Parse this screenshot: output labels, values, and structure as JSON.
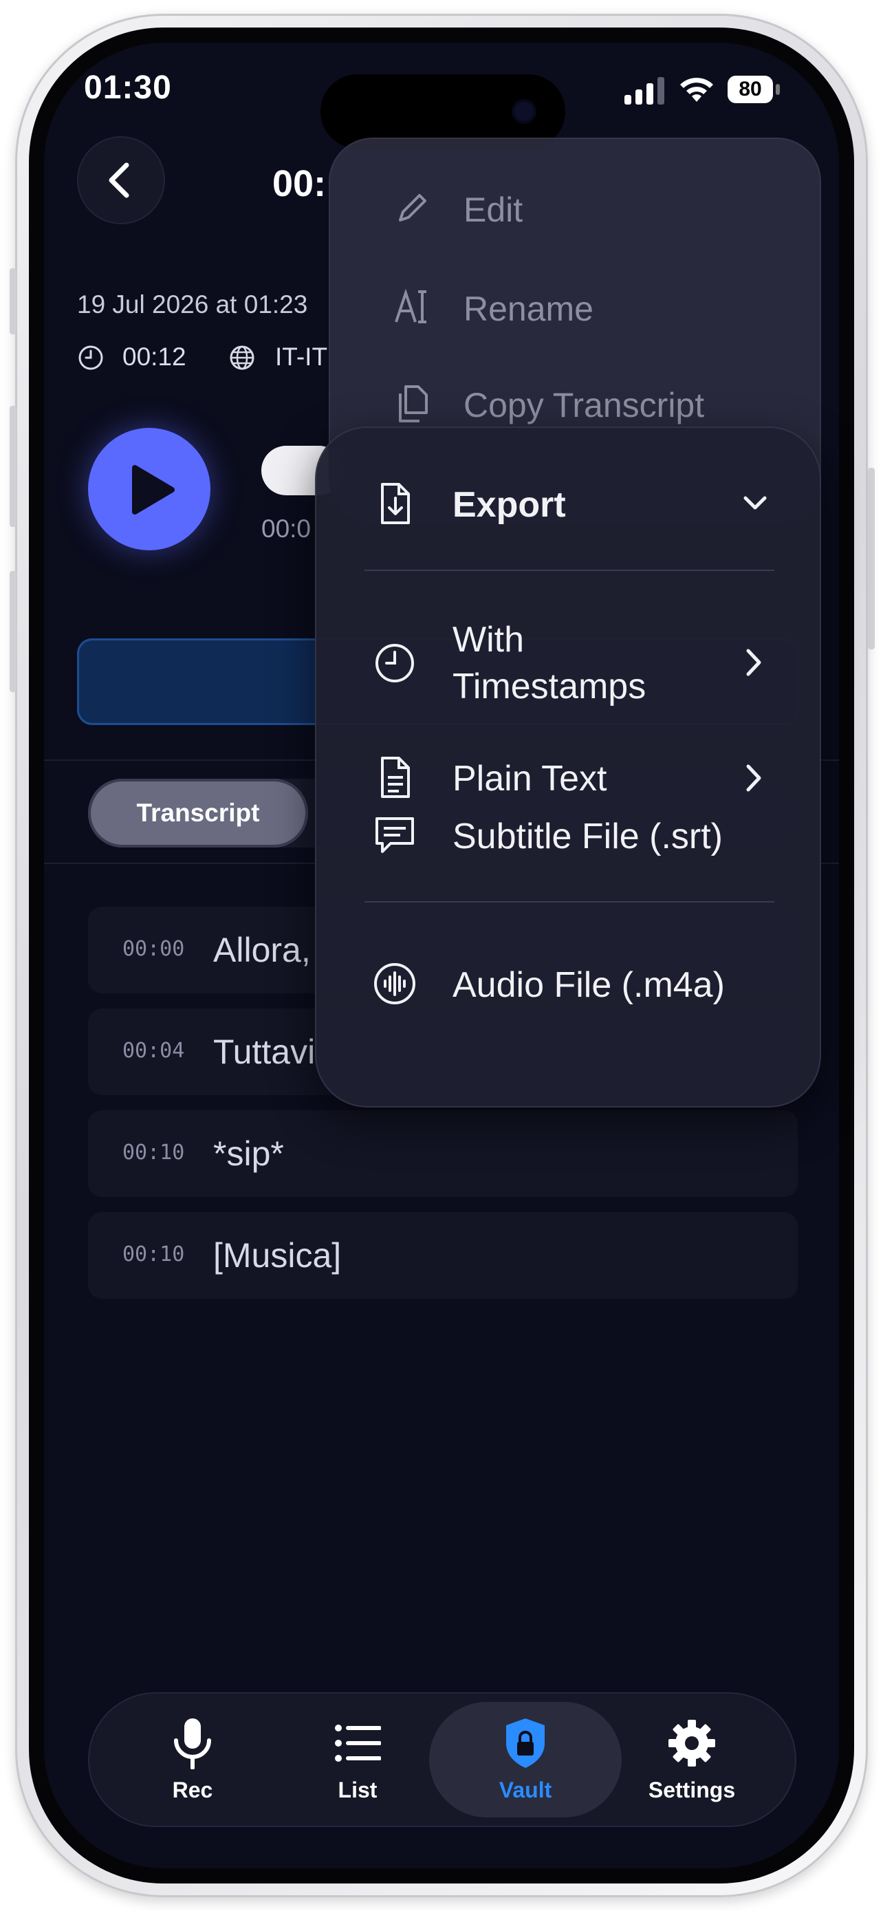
{
  "status_bar": {
    "time": "01:30",
    "battery": "80"
  },
  "header": {
    "title": "00:"
  },
  "meta": {
    "date": "19 Jul 2026 at 01:23",
    "duration": "00:12",
    "language": "IT-IT"
  },
  "player": {
    "elapsed": "00:0"
  },
  "tabs": {
    "transcript_label": "Transcript"
  },
  "transcript": [
    {
      "time": "00:00",
      "text": "Allora,"
    },
    {
      "time": "00:04",
      "text": "Tuttavi"
    },
    {
      "time": "00:10",
      "text": "*sip*"
    },
    {
      "time": "00:10",
      "text": "[Musica]"
    }
  ],
  "context_menu": {
    "items": [
      {
        "label": "Edit",
        "icon": "pencil-icon"
      },
      {
        "label": "Rename",
        "icon": "rename-icon"
      },
      {
        "label": "Copy Transcript",
        "icon": "copy-icon"
      }
    ]
  },
  "export_menu": {
    "title": "Export",
    "with_timestamps": "With\nTimestamps",
    "plain_text": "Plain Text",
    "subtitle": "Subtitle File (.srt)",
    "audio": "Audio File (.m4a)"
  },
  "tab_bar": {
    "items": [
      {
        "label": "Rec",
        "icon": "mic-icon",
        "active": false
      },
      {
        "label": "List",
        "icon": "list-icon",
        "active": false
      },
      {
        "label": "Vault",
        "icon": "lock-shield-icon",
        "active": true
      },
      {
        "label": "Settings",
        "icon": "gear-icon",
        "active": false
      }
    ]
  },
  "colors": {
    "accent": "#5a6aff",
    "vault_active": "#2a8cff",
    "background": "#0b0c1c"
  }
}
